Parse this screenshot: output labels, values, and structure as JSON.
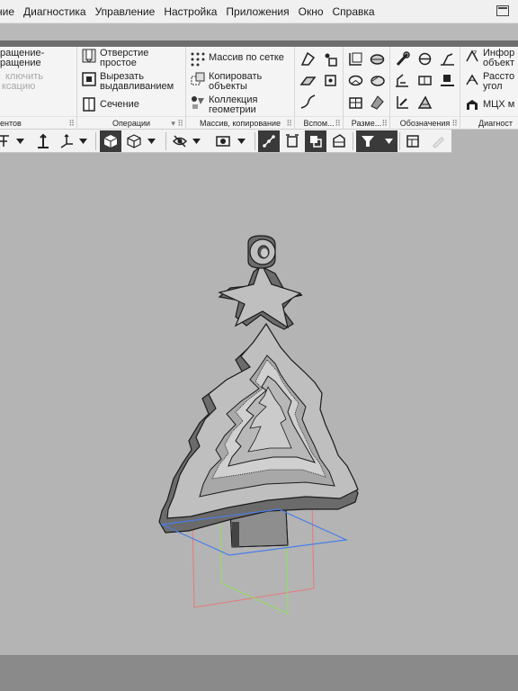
{
  "menu": {
    "items": [
      "ние",
      "Диагностика",
      "Управление",
      "Настройка",
      "Приложения",
      "Окно",
      "Справка"
    ]
  },
  "ribbon": {
    "group1": {
      "btn1": "ращение-",
      "btn1b": "ращение",
      "btn2": "ключить",
      "btn2b": "ксацию",
      "title": "ентов"
    },
    "group2": {
      "btn1": "Отверстие",
      "btn1b": "простое",
      "btn2": "Вырезать",
      "btn2b": "выдавливанием",
      "btn3": "Сечение",
      "title": "Операции"
    },
    "group3": {
      "btn1": "Массив по сетке",
      "btn2": "Копировать",
      "btn2b": "объекты",
      "btn3": "Коллекция",
      "btn3b": "геометрии",
      "title": "Массив, копирование"
    },
    "group4": {
      "title": "Вспом..."
    },
    "group5": {
      "title": "Разме..."
    },
    "group6": {
      "title": "Обозначения"
    },
    "group7": {
      "btn1": "Инфор",
      "btn1b": "объект",
      "btn2": "Рассто",
      "btn2b": "угол",
      "btn3": "МЦХ м",
      "title": "Диагност"
    }
  },
  "colors": {
    "background": "#b4b4b4",
    "ribbon": "#f4f4f4",
    "accent_dark": "#3a3a3a"
  }
}
